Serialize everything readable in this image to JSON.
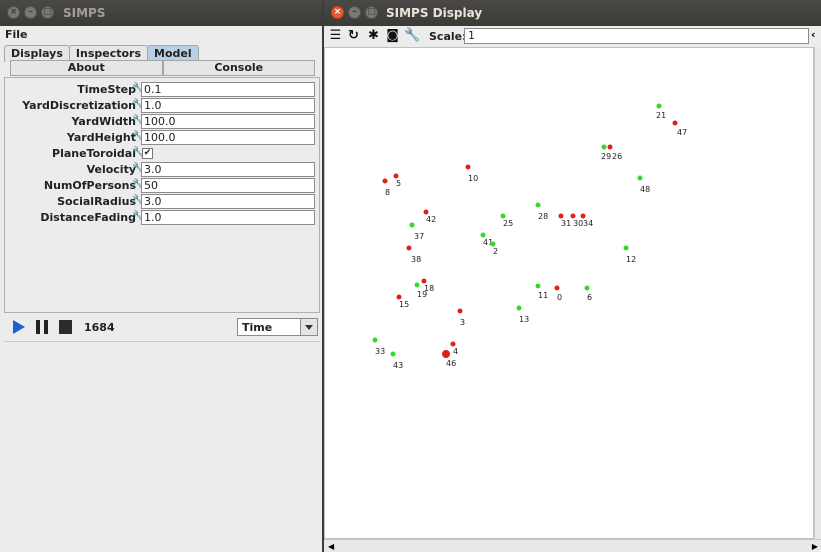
{
  "left_window": {
    "title": "SIMPS",
    "menu": "File",
    "tabs": [
      "Displays",
      "Inspectors",
      "Model"
    ],
    "subtabs": [
      "About",
      "Console"
    ],
    "properties": [
      {
        "label": "TimeStep",
        "value": "0.1"
      },
      {
        "label": "YardDiscretization",
        "value": "1.0"
      },
      {
        "label": "YardWidth",
        "value": "100.0"
      },
      {
        "label": "YardHeight",
        "value": "100.0"
      },
      {
        "label": "PlaneToroidal",
        "value": "✔"
      },
      {
        "label": "Velocity",
        "value": "3.0"
      },
      {
        "label": "NumOfPersons",
        "value": "50"
      },
      {
        "label": "SocialRadius",
        "value": "3.0"
      },
      {
        "label": "DistanceFading",
        "value": "1.0"
      }
    ],
    "steps": "1684",
    "time_select": "Time"
  },
  "right_window": {
    "title": "SIMPS Display",
    "scale_label": "Scale:",
    "scale_value": "1",
    "colors": {
      "red": "#e0201a",
      "green": "#2ddc2d"
    },
    "agents": [
      {
        "label": "21",
        "color": "green"
      },
      {
        "label": "47",
        "color": "red"
      },
      {
        "label": "29",
        "color": "green"
      },
      {
        "label": "26",
        "color": "red"
      },
      {
        "label": "48",
        "color": "green"
      },
      {
        "label": "10",
        "color": "red"
      },
      {
        "label": "8",
        "color": "red"
      },
      {
        "label": "5",
        "color": "red"
      },
      {
        "label": "42",
        "color": "red"
      },
      {
        "label": "37",
        "color": "green"
      },
      {
        "label": "28",
        "color": "green"
      },
      {
        "label": "25",
        "color": "green"
      },
      {
        "label": "31",
        "color": "red"
      },
      {
        "label": "30",
        "color": "red"
      },
      {
        "label": "34",
        "color": "red"
      },
      {
        "label": "41",
        "color": "green"
      },
      {
        "label": "2",
        "color": "green"
      },
      {
        "label": "38",
        "color": "red"
      },
      {
        "label": "12",
        "color": "green"
      },
      {
        "label": "18",
        "color": "red"
      },
      {
        "label": "19",
        "color": "green"
      },
      {
        "label": "15",
        "color": "red"
      },
      {
        "label": "11",
        "color": "green"
      },
      {
        "label": "0",
        "color": "red"
      },
      {
        "label": "6",
        "color": "green"
      },
      {
        "label": "3",
        "color": "red"
      },
      {
        "label": "13",
        "color": "green"
      },
      {
        "label": "33",
        "color": "green"
      },
      {
        "label": "43",
        "color": "green"
      },
      {
        "label": "4",
        "color": "red"
      },
      {
        "label": "46",
        "color": "red"
      }
    ]
  }
}
